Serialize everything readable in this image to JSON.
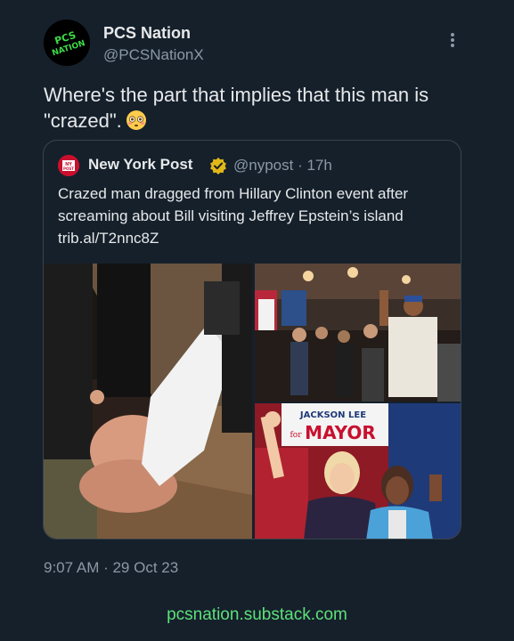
{
  "author": {
    "name": "PCS Nation",
    "handle": "@PCSNationX",
    "avatar_text": "PCS NATION",
    "avatar_bg": "#000000",
    "avatar_fg": "#3ddc4a"
  },
  "tweet": {
    "text": "Where's the part that implies that this man is \"crazed\".",
    "emoji": "flushed-face"
  },
  "quoted": {
    "name": "New York Post",
    "verified": true,
    "verified_color": "#e2b719",
    "handle": "@nypost",
    "separator": " · ",
    "age": "17h",
    "text": "Crazed man dragged from Hillary Clinton event after screaming about Bill visiting Jeffrey Epstein’s island trib.al/T2nnc8Z",
    "logo_text": "NY POST",
    "logo_color": "#c8102e",
    "media": {
      "left_photo": "shirtless man being dragged out by security",
      "top_right_photo": "crowd at campaign event",
      "bottom_right_photo": "Hillary Clinton at Jackson Lee for Mayor event",
      "sign_line1": "JACKSON LEE",
      "sign_line2": "for",
      "sign_line3": "MAYOR"
    }
  },
  "timestamp": "9:07 AM · 29 Oct 23",
  "footer": "pcsnation.substack.com",
  "colors": {
    "background": "#15202b",
    "text": "#e7e9ea",
    "secondary": "#8b98a5",
    "border": "#38444d",
    "footer_link": "#5ee07a"
  }
}
